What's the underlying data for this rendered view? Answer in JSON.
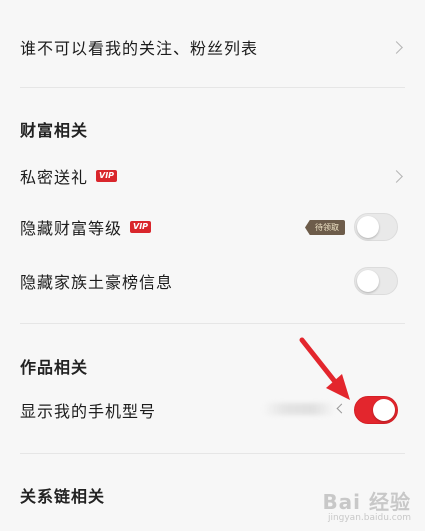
{
  "privacy": {
    "follow_list_label": "谁不可以看我的关注、粉丝列表"
  },
  "wealth": {
    "title": "财富相关",
    "private_gift_label": "私密送礼",
    "private_gift_badge": "VIP",
    "hide_level_label": "隐藏财富等级",
    "hide_level_badge": "VIP",
    "hide_level_tag": "待领取",
    "hide_level_toggle": false,
    "hide_family_label": "隐藏家族土豪榜信息",
    "hide_family_toggle": false
  },
  "works": {
    "title": "作品相关",
    "show_phone_label": "显示我的手机型号",
    "show_phone_toggle": true
  },
  "relation": {
    "title": "关系链相关"
  },
  "watermark": {
    "main": "Bai 经验",
    "sub": "jingyan.baidu.com"
  },
  "colors": {
    "accent": "#e3262d",
    "background": "#f7f7f7"
  }
}
